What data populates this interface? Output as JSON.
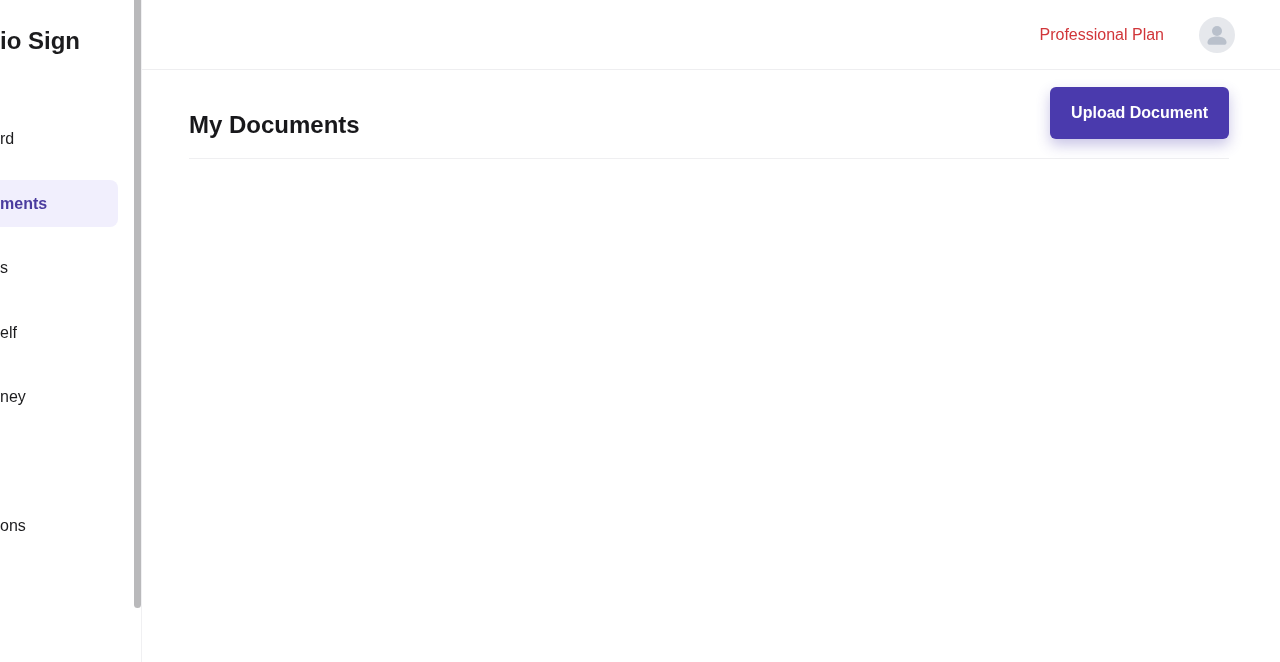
{
  "sidebar": {
    "logo": "io Sign",
    "items": [
      {
        "label": "rd",
        "selected": false
      },
      {
        "label": "ments",
        "selected": true
      },
      {
        "label": "s",
        "selected": false
      },
      {
        "label": "elf",
        "selected": false
      },
      {
        "label": "ney",
        "selected": false
      }
    ],
    "secondary_items": [
      {
        "label": "ons",
        "selected": false
      }
    ]
  },
  "header": {
    "plan": "Professional Plan"
  },
  "page": {
    "title": "My Documents",
    "upload_button": "Upload Document"
  }
}
